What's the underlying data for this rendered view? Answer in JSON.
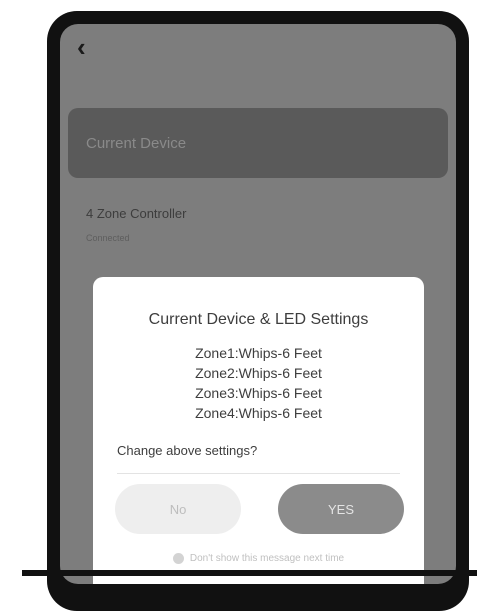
{
  "nav": {
    "back_icon": "chevron-left-icon",
    "back_glyph": "‹"
  },
  "header": {
    "title": "Current Device"
  },
  "device": {
    "name": "4 Zone Controller",
    "subtitle": "Connected"
  },
  "dialog": {
    "title": "Current Device & LED Settings",
    "zones": [
      "Zone1:Whips-6 Feet",
      "Zone2:Whips-6 Feet",
      "Zone3:Whips-6 Feet",
      "Zone4:Whips-6 Feet"
    ],
    "question": "Change above settings?",
    "no_label": "No",
    "yes_label": "YES",
    "dont_show_label": "Don't show this message next time"
  },
  "colors": {
    "overlay": "#7d7d7d",
    "primary_button": "#8b8b8b",
    "secondary_button": "#eeeeee",
    "phone_frame": "#111111"
  }
}
